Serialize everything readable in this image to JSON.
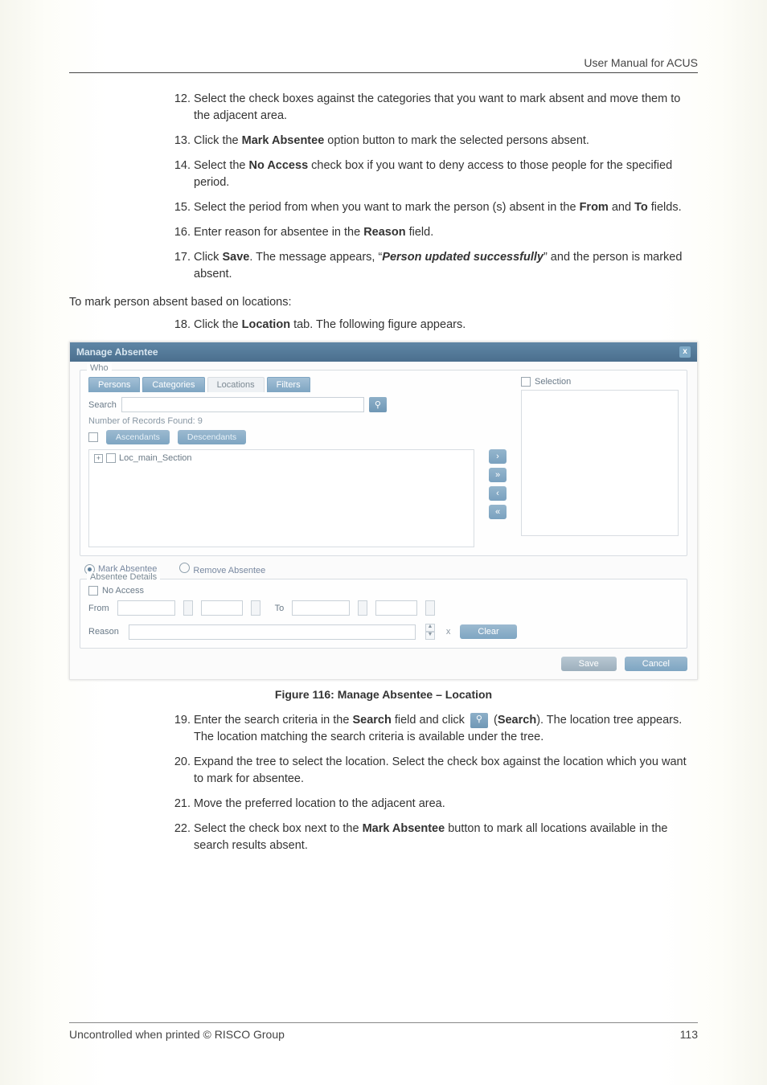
{
  "header": {
    "title": "User Manual for ACUS"
  },
  "steps12_17": [
    {
      "pre": "Select the check boxes against the categories that you want to mark absent and move them to the adjacent area."
    },
    {
      "pre": "Click the ",
      "b1": "Mark Absentee",
      "post": " option button to mark the selected persons absent."
    },
    {
      "pre": "Select the ",
      "b1": "No Access",
      "post": " check box if you want to deny access to those people for the specified period."
    },
    {
      "pre": "Select the period from when you want to mark the person (s) absent in the ",
      "b1": "From",
      "mid": " and ",
      "b2": "To",
      "post": " fields."
    },
    {
      "pre": "Enter reason for absentee in the ",
      "b1": "Reason",
      "post": " field."
    },
    {
      "pre": "Click ",
      "b1": "Save",
      "mid": ". The message appears, “",
      "ital": "Person updated successfully",
      "post": "” and the person is marked absent."
    }
  ],
  "para_locations": "To mark person absent based on locations:",
  "step18": {
    "pre": "Click the ",
    "b1": "Location",
    "post": " tab. The following figure appears."
  },
  "window": {
    "title": "Manage Absentee",
    "who_legend": "Who",
    "tabs": {
      "persons": "Persons",
      "categories": "Categories",
      "locations": "Locations",
      "filters": "Filters"
    },
    "search_label": "Search",
    "records_found": "Number of Records Found: 9",
    "ascendants_btn": "Ascendants",
    "descendants_btn": "Descendants",
    "tree_item": "Loc_main_Section",
    "selection_label": "Selection",
    "radio_mark": "Mark Absentee",
    "radio_remove": "Remove Absentee",
    "details_legend": "Absentee Details",
    "no_access": "No Access",
    "from_label": "From",
    "to_label": "To",
    "reason_label": "Reason",
    "clear_btn": "Clear",
    "save_btn": "Save",
    "cancel_btn": "Cancel",
    "arrows": {
      "r": "›",
      "rr": "»",
      "l": "‹",
      "ll": "«"
    }
  },
  "figure_caption": "Figure 116: Manage Absentee – Location",
  "steps19_22": [
    {
      "pre": "Enter the search criteria in the ",
      "b1": "Search",
      "mid": " field and click ",
      "icon": true,
      "post_b": "Search",
      "post2": "). The location tree appears. The location matching the search criteria is available under the tree."
    },
    {
      "pre": "Expand the tree to select the location. Select the check box against the location which you want to mark for absentee."
    },
    {
      "pre": "Move the preferred location to the adjacent area."
    },
    {
      "pre": "Select the check box next to the ",
      "b1": "Mark Absentee",
      "post": " button to mark all locations available in the search results absent."
    }
  ],
  "footer": {
    "left": "Uncontrolled when printed © RISCO Group",
    "right": "113"
  },
  "glyphs": {
    "magnify": "⚲",
    "plus": "+",
    "x": "x",
    "up": "▲",
    "dn": "▼"
  }
}
